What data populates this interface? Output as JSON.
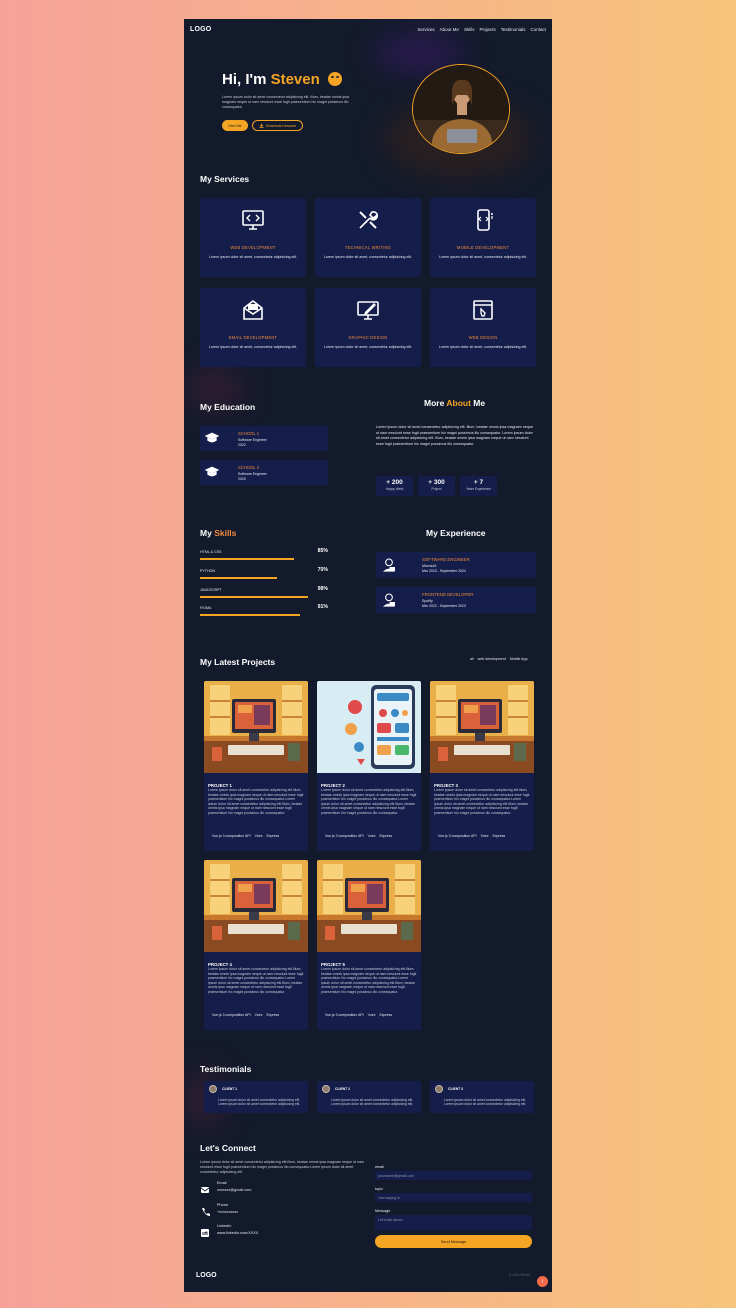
{
  "nav": {
    "logo": "LOGO",
    "links": [
      "Services",
      "About Me",
      "Skills",
      "Projects",
      "Testimonials",
      "Contact"
    ]
  },
  "hero": {
    "greeting": "Hi, I'm",
    "name": "Steven",
    "description": "Lorem ipsum dolor sit amet consectetur adipisicing elit. Illum, beatae omnis ipsa magnam neque ut nam nesciunt esse fugit praesentium hic magni possimus illo consequatur.",
    "hire_label": "Hire Me",
    "download_label": "Download resume"
  },
  "services": {
    "title": "My Services",
    "items": [
      {
        "title": "WEB DEVELOPMENT",
        "desc": "Lorem ipsum dolor sit amet, consectetur adipisicing elit.",
        "icon": "web-dev-icon"
      },
      {
        "title": "TECHNICAL WRITING",
        "desc": "Lorem ipsum dolor sit amet, consectetur adipisicing elit.",
        "icon": "tools-icon"
      },
      {
        "title": "MOBILE DEVELOPMENT",
        "desc": "Lorem ipsum dolor sit amet, consectetur adipisicing elit.",
        "icon": "mobile-icon"
      },
      {
        "title": "EMAIL DEVELOPMENT",
        "desc": "Lorem ipsum dolor sit amet, consectetur adipisicing elit.",
        "icon": "mail-icon"
      },
      {
        "title": "GRAPHIC DESIGN",
        "desc": "Lorem ipsum dolor sit amet, consectetur adipisicing elit.",
        "icon": "design-icon"
      },
      {
        "title": "WEB DESIGN",
        "desc": "Lorem ipsum dolor sit amet, consectetur adipisicing elit.",
        "icon": "web-design-icon"
      }
    ]
  },
  "education": {
    "title": "My Education",
    "items": [
      {
        "school": "SCHOOL 1",
        "role": "Software Engineer",
        "year": "2022"
      },
      {
        "school": "SCHOOL 2",
        "role": "Software Engineer",
        "year": "2020"
      }
    ]
  },
  "about": {
    "title_pre": "More",
    "title_accent": "About",
    "title_post": "Me",
    "text": "Lorem ipsum dolor sit amet consectetur adipisicing elit. Illum, beatae omnis ipsa magnam neque ut nam nesciunt esse fugit praesentium hic magni possimus illo consequatur. Lorem ipsum dolor sit amet consectetur adipisicing elit. Illum, beatae omnis ipsa magnam neque ut nam nesciunt esse fugit praesentium hic magni possimus illo consequatur.",
    "stats": [
      {
        "num": "+ 200",
        "label": "Happy client"
      },
      {
        "num": "+ 300",
        "label": "Project"
      },
      {
        "num": "+ 7",
        "label": "Years Experience"
      }
    ]
  },
  "skills": {
    "title_pre": "My",
    "title_accent": "Skills",
    "items": [
      {
        "name": "HTML & CSS",
        "percent": "85%",
        "value": 0.85
      },
      {
        "name": "PYTHON",
        "percent": "70%",
        "value": 0.7
      },
      {
        "name": "JAVASCRIPT",
        "percent": "98%",
        "value": 0.98
      },
      {
        "name": "FIGMA",
        "percent": "91%",
        "value": 0.91
      }
    ]
  },
  "experience": {
    "title": "My Experience",
    "items": [
      {
        "role": "SOFTWARE ENGINEER",
        "company": "Microsoft",
        "period": "Mar 2023 - September 2024"
      },
      {
        "role": "FRONTEND DEVELOPER",
        "company": "Spotify",
        "period": "Mar 2022 - September 2023"
      }
    ]
  },
  "projects": {
    "title": "My Latest Projects",
    "filters": [
      "all",
      "web development",
      "Mobile App"
    ],
    "desc": "Lorem ipsum dolor sit amet consectetur adipisicing elit.Illum, beatae omnis ipsa magnam neque ut nam nesciunt esse fugit praesentium hic magni possimus illo consequatur.Lorem ipsum dolor sit amet consectetur adipisicing elit.Illum, beatae omnis ipsa magnam neque ut nam nesciunt esse fugit praesentium hic magni possimus illo consequatur.",
    "tags": [
      "Vue.js 3 composition API",
      "Vuex",
      "Express"
    ],
    "items": [
      {
        "title": "PROJECT 1"
      },
      {
        "title": "PROJECT 2"
      },
      {
        "title": "PROJECT 3"
      },
      {
        "title": "PROJECT 4"
      },
      {
        "title": "PROJECT 5"
      }
    ]
  },
  "testimonials": {
    "title": "Testimonials",
    "items": [
      {
        "name": "CLIENT 1",
        "quote": "Lorem ipsum dolor sit amet consectetur adipisicing elit. Lorem ipsum dolor sit amet consectetur adipisicing elit."
      },
      {
        "name": "CLIENT 2",
        "quote": "Lorem ipsum dolor sit amet consectetur adipisicing elit. Lorem ipsum dolor sit amet consectetur adipisicing elit."
      },
      {
        "name": "CLIENT 3",
        "quote": "Lorem ipsum dolor sit amet consectetur adipisicing elit. Lorem ipsum dolor sit amet consectetur adipisicing elit."
      }
    ]
  },
  "connect": {
    "title": "Let's Connect",
    "text": "Lorem ipsum dolor sit amet consectetur adipisicing elit.Illum, beatae omnis ipsa magnam neque ut nam nesciunt esse fugit praesentium hic magni possimus illo consequatur.Lorem ipsum dolor sit amet consectetur adipisicing elit.",
    "contacts": [
      {
        "key": "Email",
        "value": "xxxxxxx@gmail.com"
      },
      {
        "key": "Phone",
        "value": "+xxxxxxxxxx"
      },
      {
        "key": "LinkedIn",
        "value": "www.linkedin.com/XXXX"
      }
    ],
    "form": {
      "email_label": "email",
      "email_placeholder": "yourname@gmail.com",
      "topic_label": "topic",
      "topic_placeholder": "Just saying hi",
      "message_label": "Message",
      "message_placeholder": "Let's talk about...",
      "send_label": "Send Message"
    }
  },
  "footer": {
    "logo": "LOGO",
    "copyright": "© 2024 Steven"
  },
  "colors": {
    "accent": "#f5a524",
    "accent_text": "#f08a3c",
    "card": "#151e4a",
    "bg": "#131a2b"
  }
}
